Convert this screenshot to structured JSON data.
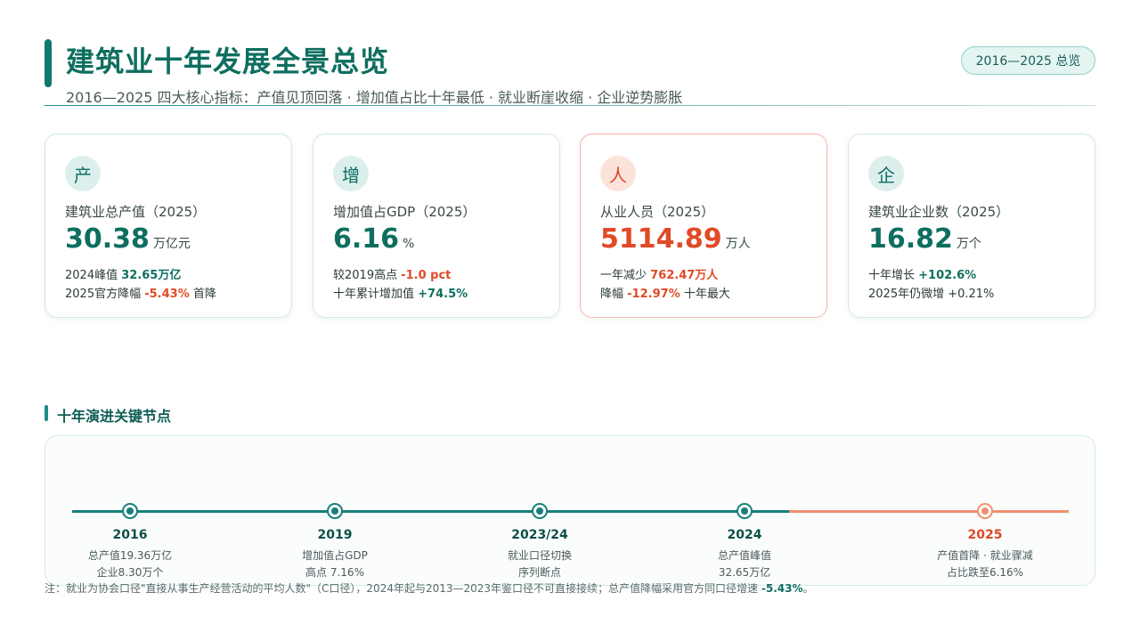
{
  "header": {
    "title": "建筑业十年发展全景总览",
    "subtitle": "2016—2025 四大核心指标：产值见顶回落 · 增加值占比十年最低 · 就业断崖收缩 · 企业逆势膨胀",
    "badge": "2016—2025 总览"
  },
  "cards": [
    {
      "icon": "产",
      "label": "建筑业总产值（2025）",
      "value": "30.38",
      "unit": "万亿元",
      "line1": {
        "pre": "2024峰值 ",
        "hl": "32.65万亿",
        "post": ""
      },
      "line2": {
        "pre": "2025官方降幅 ",
        "hl": "-5.43%",
        "post": " 首降"
      }
    },
    {
      "icon": "增",
      "label": "增加值占GDP（2025）",
      "value": "6.16",
      "unit": "%",
      "line1": {
        "pre": "较2019高点 ",
        "hl": "-1.0 pct",
        "post": ""
      },
      "line2": {
        "pre": "十年累计增加值 ",
        "hl": "+74.5%",
        "post": ""
      }
    },
    {
      "icon": "人",
      "label": "从业人员（2025）",
      "value": "5114.89",
      "unit": "万人",
      "line1": {
        "pre": "一年减少 ",
        "hl": "762.47万人",
        "post": ""
      },
      "line2": {
        "pre": "降幅 ",
        "hl": "-12.97%",
        "post": " 十年最大"
      }
    },
    {
      "icon": "企",
      "label": "建筑业企业数（2025）",
      "value": "16.82",
      "unit": "万个",
      "line1": {
        "pre": "十年增长 ",
        "hl": "+102.6%",
        "post": ""
      },
      "line2": {
        "pre": "2025年仍微增 +0.21%",
        "hl": "",
        "post": ""
      }
    }
  ],
  "timeline": {
    "title": "十年演进关键节点",
    "nodes": [
      {
        "year": "2016",
        "desc1": "总产值19.36万亿",
        "desc2": "企业8.30万个"
      },
      {
        "year": "2019",
        "desc1": "增加值占GDP",
        "desc2": "高点 7.16%"
      },
      {
        "year": "2023/24",
        "desc1": "就业口径切换",
        "desc2": "序列断点"
      },
      {
        "year": "2024",
        "desc1": "总产值峰值",
        "desc2": "32.65万亿"
      },
      {
        "year": "2025",
        "desc1": "产值首降 · 就业骤减",
        "desc2": "占比跌至6.16%"
      }
    ]
  },
  "note": {
    "text": "注：就业为协会口径\"直接从事生产经营活动的平均人数\"（C口径），2024年起与2013—2023年鉴口径不可直接接续；总产值降幅采用官方同口径增速 ",
    "hl": "-5.43%",
    "end": "。"
  },
  "colors": {
    "primary": "#0e6e5f",
    "accent_red": "#e04a25",
    "timeline_teal": "#167f79",
    "timeline_orange": "#ef8f6e"
  }
}
